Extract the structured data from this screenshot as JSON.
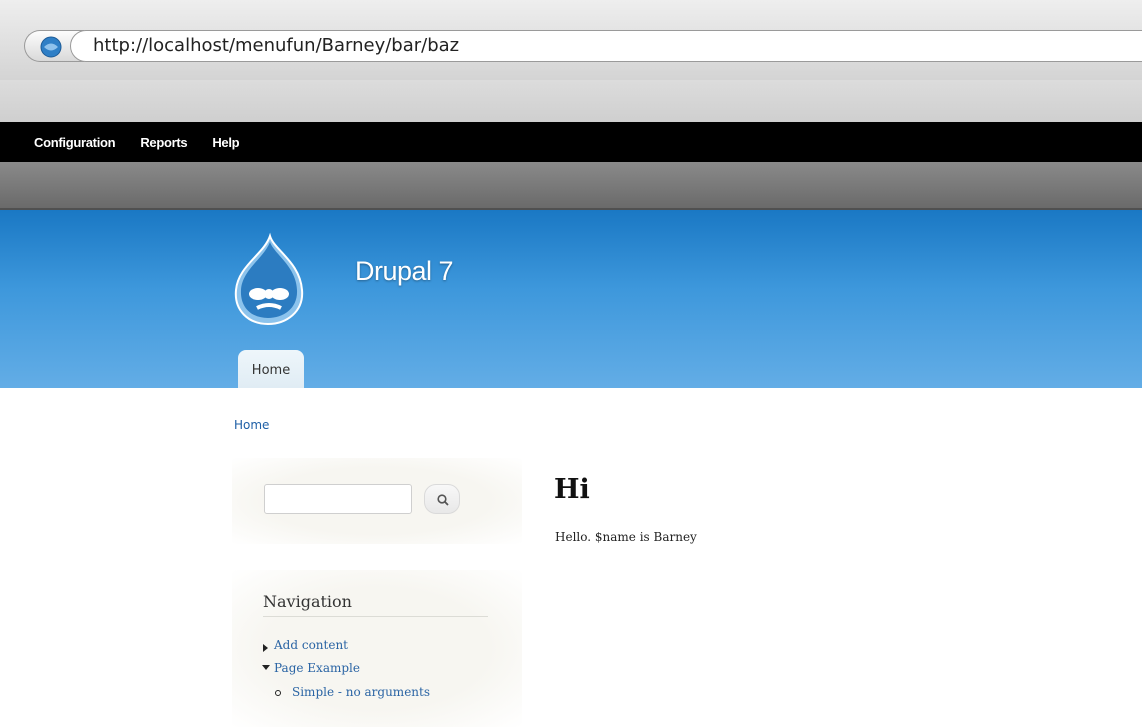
{
  "browser": {
    "url": "http://localhost/menufun/Barney/bar/baz"
  },
  "toolbar": {
    "items": [
      "Configuration",
      "Reports",
      "Help"
    ]
  },
  "header": {
    "site_name": "Drupal 7",
    "tabs": [
      "Home"
    ]
  },
  "breadcrumb": {
    "home": "Home"
  },
  "search": {
    "value": "",
    "icon": "search-icon"
  },
  "navigation": {
    "title": "Navigation",
    "items": [
      {
        "label": "Add content",
        "marker": "collapsed"
      },
      {
        "label": "Page Example",
        "marker": "expanded"
      },
      {
        "label": "Simple - no arguments",
        "marker": "leaf"
      }
    ]
  },
  "content": {
    "title": "Hi",
    "body": "Hello. $name is Barney"
  },
  "colors": {
    "toolbar_bg": "#000000",
    "header_blue": "#3e98dc",
    "link_blue": "#2a64a4"
  }
}
